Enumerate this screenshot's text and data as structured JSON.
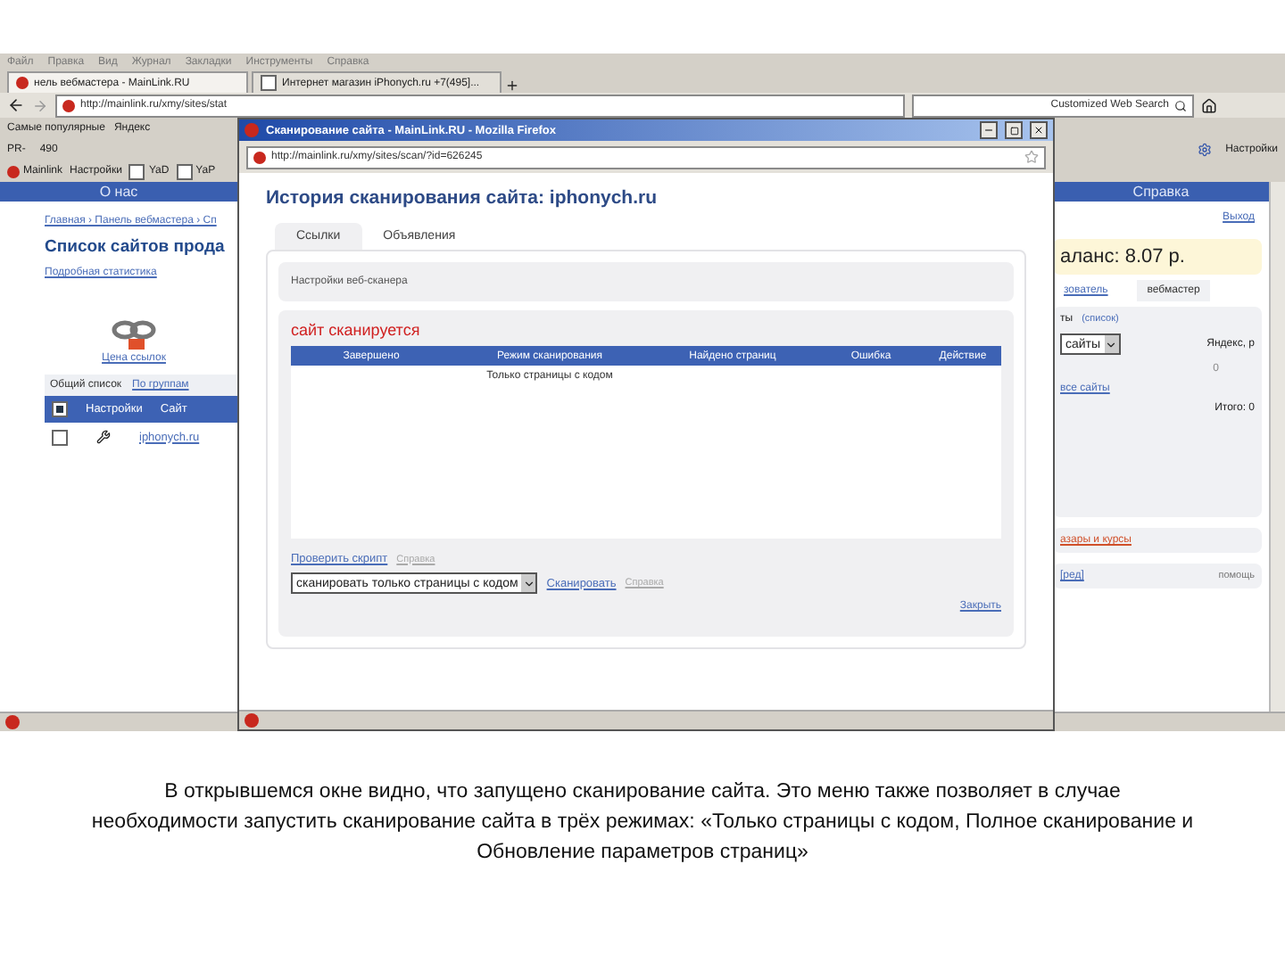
{
  "browser": {
    "menu": [
      "Файл",
      "Правка",
      "Вид",
      "Журнал",
      "Закладки",
      "Инструменты",
      "Справка"
    ],
    "tabs": [
      {
        "label": "нель вебмастера - MainLink.RU",
        "selected": true
      },
      {
        "label": "Интернет магазин iPhonych.ru +7(495]...",
        "selected": false
      }
    ],
    "url": "http://mainlink.ru/xmy/sites/stat",
    "search_placeholder": "Customized Web Search",
    "bookmarks": [
      "Самые популярные",
      "Яндекс"
    ],
    "toolbar": [
      "PR-",
      "490"
    ],
    "addon_bar": [
      {
        "label": "Mainlink",
        "kind": "logo"
      },
      {
        "label": "Настройки",
        "kind": "text"
      },
      {
        "label": "YaD",
        "kind": "checkbox",
        "checked": false
      },
      {
        "label": "YaP",
        "kind": "checkbox",
        "checked": false
      }
    ],
    "settings": "Настройки"
  },
  "page": {
    "nav": [
      "О нас",
      "Справка"
    ],
    "breadcrumb": "Главная › Панель вебмастера › Сп",
    "heading": "Список сайтов прода",
    "stats_link": "Подробная статистика",
    "price_link": "Цена ссылок",
    "list_tabs": [
      {
        "label": "Общий список",
        "selected": true
      },
      {
        "label": "По группам",
        "selected": false
      }
    ],
    "table": {
      "all_checked": true,
      "columns": [
        "Настройки",
        "Сайт"
      ],
      "rows": [
        {
          "checked": false,
          "site": "iphonych.ru"
        }
      ]
    }
  },
  "side": {
    "logout": "Выход",
    "balance": "аланс: 8.07 р.",
    "tabs": [
      {
        "label": "зователь",
        "selected": false
      },
      {
        "label": "вебмастер",
        "selected": true
      }
    ],
    "sites": "ты",
    "sites_link": "(список)",
    "select": "сайты",
    "yandex": "Яндекс, р",
    "zero": "0",
    "all_link": "все сайты",
    "total": "Итого: 0",
    "news_link": "азары и курсы",
    "bottom_link": "[ред]",
    "help": "помощь"
  },
  "popup": {
    "title": "Сканирование сайта - MainLink.RU - Mozilla Firefox",
    "url": "http://mainlink.ru/xmy/sites/scan/?id=626245",
    "heading": "История сканирования сайта: iphonych.ru",
    "tabs": [
      {
        "label": "Ссылки",
        "selected": true
      },
      {
        "label": "Объявления",
        "selected": false
      }
    ],
    "settings": "Настройки веб-сканера",
    "status": "сайт сканируется",
    "columns": [
      "Завершено",
      "Режим сканирования",
      "Найдено страниц",
      "Ошибка",
      "Действие"
    ],
    "rows": [
      {
        "cells": [
          "",
          "Только страницы с кодом",
          "",
          "",
          ""
        ]
      }
    ],
    "check_link": "Проверить скрипт",
    "check_help": "Справка",
    "mode": "сканировать только страницы с кодом",
    "scan": "Сканировать",
    "scan_help": "Справка",
    "close": "Закрыть"
  },
  "caption": "В открывшемся окне видно, что запущено сканирование сайта. Это меню также позволяет в случае необходимости запустить сканирование сайта в трёх режимах: «Только страницы с кодом, Полное сканирование и Обновление параметров страниц»"
}
